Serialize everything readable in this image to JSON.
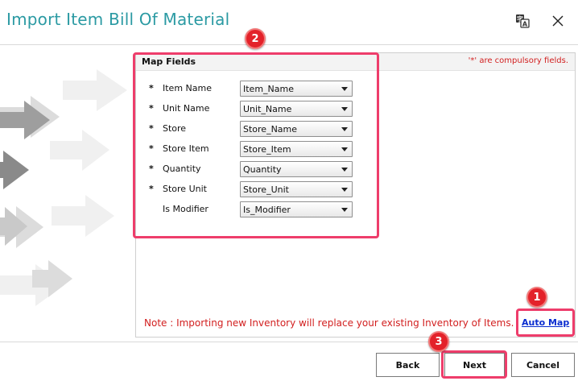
{
  "window": {
    "title": "Import Item Bill Of Material",
    "icons": {
      "translate": "translate-icon",
      "close": "close-icon"
    }
  },
  "map_fields": {
    "title": "Map Fields",
    "compulsory_note": "'*' are compulsory fields.",
    "fields": [
      {
        "required": "*",
        "label": "Item Name",
        "value": "Item_Name"
      },
      {
        "required": "*",
        "label": "Unit Name",
        "value": "Unit_Name"
      },
      {
        "required": "*",
        "label": "Store",
        "value": "Store_Name"
      },
      {
        "required": "*",
        "label": "Store Item",
        "value": "Store_Item"
      },
      {
        "required": "*",
        "label": "Quantity",
        "value": "Quantity"
      },
      {
        "required": "*",
        "label": "Store Unit",
        "value": "Store_Unit"
      },
      {
        "required": "",
        "label": "Is Modifier",
        "value": "Is_Modifier"
      }
    ]
  },
  "note": "Note : Importing new Inventory will replace your existing Inventory of Items.",
  "auto_map_label": "Auto Map",
  "buttons": {
    "back": "Back",
    "next": "Next",
    "cancel": "Cancel"
  },
  "callouts": {
    "auto_map": "1",
    "map_fields": "2",
    "next": "3"
  },
  "colors": {
    "title": "#2b9aa3",
    "highlight": "#ee3d6b",
    "callout": "#e3222a",
    "warning": "#d21f1f",
    "link": "#0a2ccf"
  }
}
